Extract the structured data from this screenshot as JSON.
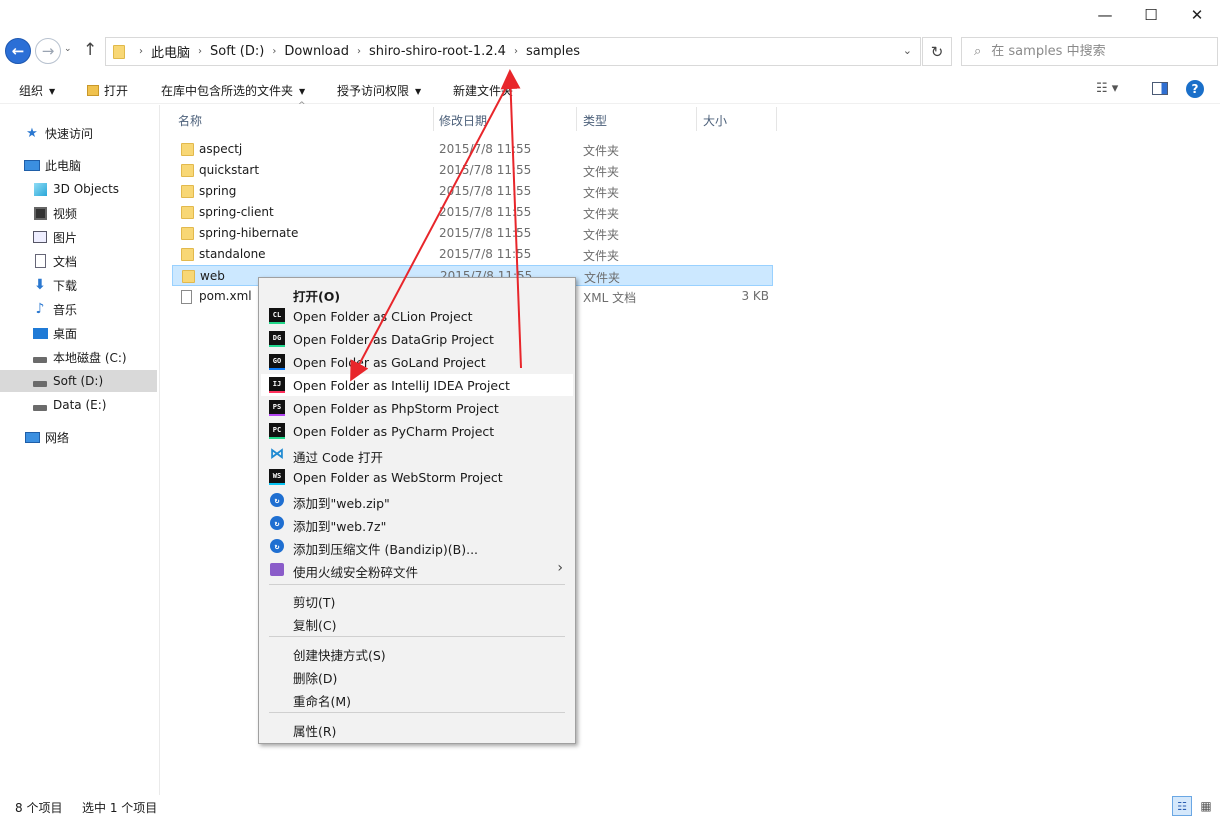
{
  "window_controls": {
    "minimize": "—",
    "maximize": "☐",
    "close": "✕"
  },
  "nav": {
    "back": "←",
    "forward": "→",
    "recent": "⌄",
    "up": "↑"
  },
  "address": {
    "breadcrumbs": [
      "此电脑",
      "Soft (D:)",
      "Download",
      "shiro-shiro-root-1.2.4",
      "samples"
    ],
    "separator": "›",
    "dropdown": "⌄",
    "refresh": "↻"
  },
  "search": {
    "placeholder": "在 samples 中搜索",
    "icon": "⌕"
  },
  "commands": {
    "organize": "组织",
    "open": "打开",
    "include_in_library": "在库中包含所选的文件夹",
    "share_with": "授予访问权限",
    "new_folder": "新建文件夹",
    "caret": "▼",
    "view_options": "☷ ▾",
    "help": "?"
  },
  "sidebar": {
    "items": [
      {
        "label": "快速访问",
        "icon": "star-icon"
      },
      {
        "label": "此电脑",
        "icon": "computer-icon"
      },
      {
        "label": "3D Objects",
        "icon": "cube-icon"
      },
      {
        "label": "视频",
        "icon": "video-icon"
      },
      {
        "label": "图片",
        "icon": "picture-icon"
      },
      {
        "label": "文档",
        "icon": "document-icon"
      },
      {
        "label": "下载",
        "icon": "download-icon"
      },
      {
        "label": "音乐",
        "icon": "music-icon"
      },
      {
        "label": "桌面",
        "icon": "desktop-icon"
      },
      {
        "label": "本地磁盘 (C:)",
        "icon": "drive-icon"
      },
      {
        "label": "Soft (D:)",
        "icon": "drive-icon"
      },
      {
        "label": "Data (E:)",
        "icon": "drive-icon"
      },
      {
        "label": "网络",
        "icon": "network-icon"
      }
    ],
    "glyphs": {
      "star": "★",
      "down": "⬇",
      "music": "♪"
    }
  },
  "columns": {
    "name": "名称",
    "modified": "修改日期",
    "type": "类型",
    "size": "大小",
    "sort_indicator": "^"
  },
  "files": [
    {
      "name": "aspectj",
      "modified": "2015/7/8 11:55",
      "type": "文件夹",
      "size": ""
    },
    {
      "name": "quickstart",
      "modified": "2015/7/8 11:55",
      "type": "文件夹",
      "size": ""
    },
    {
      "name": "spring",
      "modified": "2015/7/8 11:55",
      "type": "文件夹",
      "size": ""
    },
    {
      "name": "spring-client",
      "modified": "2015/7/8 11:55",
      "type": "文件夹",
      "size": ""
    },
    {
      "name": "spring-hibernate",
      "modified": "2015/7/8 11:55",
      "type": "文件夹",
      "size": ""
    },
    {
      "name": "standalone",
      "modified": "2015/7/8 11:55",
      "type": "文件夹",
      "size": ""
    },
    {
      "name": "web",
      "modified": "2015/7/8 11:55",
      "type": "文件夹",
      "size": ""
    },
    {
      "name": "pom.xml",
      "modified": "",
      "type": "XML 文档",
      "size": "3 KB"
    }
  ],
  "context_menu": {
    "items": [
      {
        "label": "打开(O)",
        "icon": ""
      },
      {
        "label": "Open Folder as CLion Project",
        "icon": "CL"
      },
      {
        "label": "Open Folder as DataGrip Project",
        "icon": "DG"
      },
      {
        "label": "Open Folder as GoLand Project",
        "icon": "GO"
      },
      {
        "label": "Open Folder as IntelliJ IDEA Project",
        "icon": "IJ"
      },
      {
        "label": "Open Folder as PhpStorm Project",
        "icon": "PS"
      },
      {
        "label": "Open Folder as PyCharm Project",
        "icon": "PC"
      },
      {
        "label": "通过 Code 打开",
        "icon": "⋈"
      },
      {
        "label": "Open Folder as WebStorm Project",
        "icon": "WS"
      },
      {
        "label": "添加到\"web.zip\"",
        "icon": "↻"
      },
      {
        "label": "添加到\"web.7z\"",
        "icon": "↻"
      },
      {
        "label": "添加到压缩文件 (Bandizip)(B)...",
        "icon": "↻"
      },
      {
        "label": "使用火绒安全粉碎文件",
        "icon": ""
      },
      {
        "label": "剪切(T)",
        "icon": ""
      },
      {
        "label": "复制(C)",
        "icon": ""
      },
      {
        "label": "创建快捷方式(S)",
        "icon": ""
      },
      {
        "label": "删除(D)",
        "icon": ""
      },
      {
        "label": "重命名(M)",
        "icon": ""
      },
      {
        "label": "属性(R)",
        "icon": ""
      }
    ],
    "submenu_arrow": "›"
  },
  "status_bar": {
    "item_count": "8 个项目",
    "selected_count": "选中 1 个项目",
    "details_view": "☷",
    "icons_view": "▦"
  },
  "colors": {
    "selection": "#cce8ff",
    "selection_border": "#99d1ff",
    "annotation_arrow": "#e8262b",
    "accent": "#2b6fd6"
  }
}
